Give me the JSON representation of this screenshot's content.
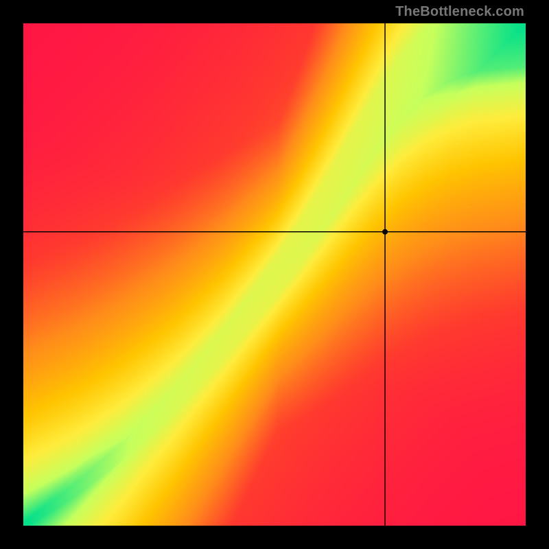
{
  "watermark": "TheBottleneck.com",
  "chart_data": {
    "type": "heatmap",
    "title": "",
    "xlabel": "",
    "ylabel": "",
    "x_range": [
      0,
      1
    ],
    "y_range": [
      0,
      1
    ],
    "marker": {
      "x": 0.72,
      "y": 0.585
    },
    "crosshair": {
      "x": 0.72,
      "y": 0.585
    },
    "colormap": {
      "stops": [
        {
          "v": 0.0,
          "color": "#ff1744"
        },
        {
          "v": 0.18,
          "color": "#ff3a2e"
        },
        {
          "v": 0.38,
          "color": "#ff8c1a"
        },
        {
          "v": 0.58,
          "color": "#ffc400"
        },
        {
          "v": 0.74,
          "color": "#ffeb3b"
        },
        {
          "v": 0.88,
          "color": "#c6ff5c"
        },
        {
          "v": 1.0,
          "color": "#00e08a"
        }
      ]
    },
    "ideal_curve": {
      "description": "y position of the green optimum ridge as a function of x (both 0..1, origin bottom-left)",
      "points": [
        {
          "x": 0.0,
          "y": 0.0
        },
        {
          "x": 0.1,
          "y": 0.068
        },
        {
          "x": 0.2,
          "y": 0.15
        },
        {
          "x": 0.3,
          "y": 0.248
        },
        {
          "x": 0.4,
          "y": 0.362
        },
        {
          "x": 0.5,
          "y": 0.49
        },
        {
          "x": 0.55,
          "y": 0.56
        },
        {
          "x": 0.6,
          "y": 0.638
        },
        {
          "x": 0.65,
          "y": 0.72
        },
        {
          "x": 0.7,
          "y": 0.8
        },
        {
          "x": 0.75,
          "y": 0.87
        },
        {
          "x": 0.8,
          "y": 0.922
        },
        {
          "x": 0.85,
          "y": 0.958
        },
        {
          "x": 0.9,
          "y": 0.982
        },
        {
          "x": 1.0,
          "y": 1.0
        }
      ]
    },
    "band_halfwidth": {
      "description": "half-width of the green band at given x (fraction of plot height)",
      "points": [
        {
          "x": 0.0,
          "w": 0.006
        },
        {
          "x": 0.1,
          "w": 0.012
        },
        {
          "x": 0.25,
          "w": 0.02
        },
        {
          "x": 0.4,
          "w": 0.03
        },
        {
          "x": 0.55,
          "w": 0.045
        },
        {
          "x": 0.7,
          "w": 0.06
        },
        {
          "x": 0.85,
          "w": 0.072
        },
        {
          "x": 1.0,
          "w": 0.085
        }
      ]
    },
    "diagonal_falloff": 0.55
  }
}
